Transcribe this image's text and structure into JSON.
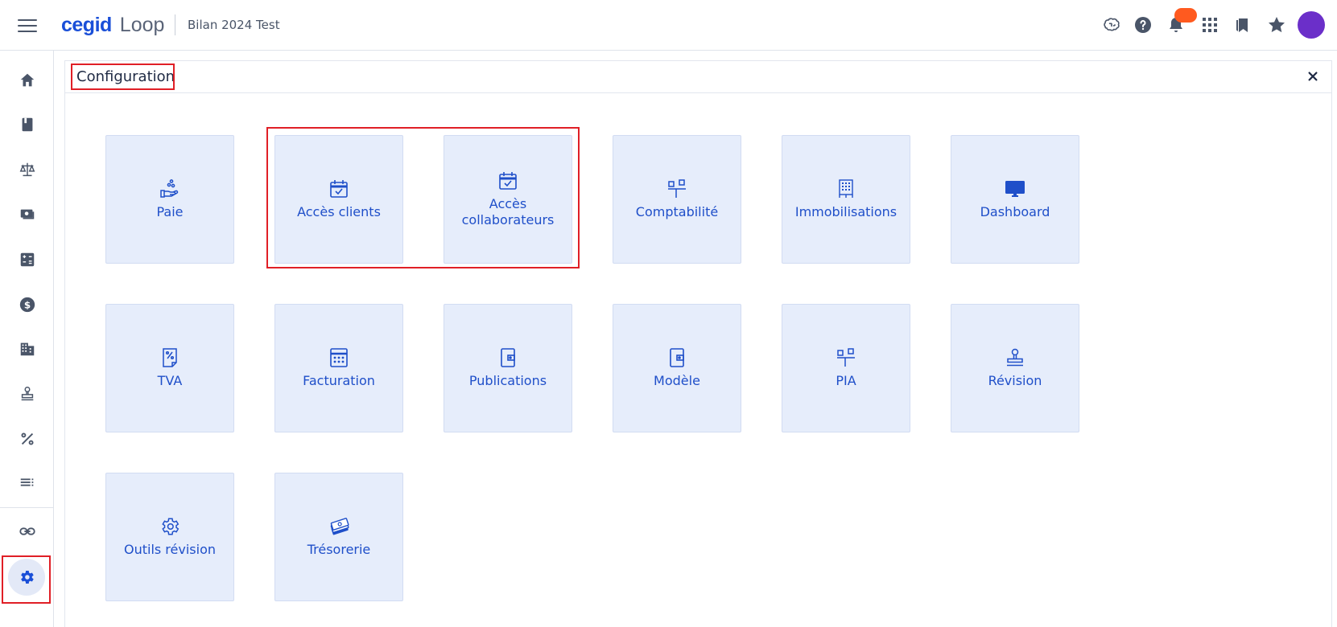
{
  "header": {
    "brand_primary": "cegid",
    "brand_secondary": "Loop",
    "document_title": "Bilan 2024 Test",
    "icons": [
      "brain-icon",
      "help-icon",
      "bell-icon",
      "apps-grid-icon",
      "bookmarks-icon",
      "star-icon",
      "avatar"
    ]
  },
  "sidebar": {
    "items": [
      {
        "icon": "home-icon"
      },
      {
        "icon": "book-icon"
      },
      {
        "icon": "scale-icon"
      },
      {
        "icon": "payments-icon"
      },
      {
        "icon": "calculator-icon"
      },
      {
        "icon": "dollar-icon"
      },
      {
        "icon": "building-icon"
      },
      {
        "icon": "stamp-icon"
      },
      {
        "icon": "percent-icon"
      },
      {
        "icon": "list-icon"
      },
      {
        "icon": "link-icon"
      },
      {
        "icon": "settings-icon",
        "active": true
      }
    ]
  },
  "panel": {
    "title": "Configuration",
    "tiles": [
      {
        "label": "Paie",
        "icon": "hand-coins-icon"
      },
      {
        "label": "Accès clients",
        "icon": "calendar-check-icon"
      },
      {
        "label": "Accès collaborateurs",
        "icon": "calendar-check-icon"
      },
      {
        "label": "Comptabilité",
        "icon": "org-chart-icon"
      },
      {
        "label": "Immobilisations",
        "icon": "building-grid-icon"
      },
      {
        "label": "Dashboard",
        "icon": "monitor-icon"
      },
      {
        "label": "TVA",
        "icon": "percent-doc-icon"
      },
      {
        "label": "Facturation",
        "icon": "calculator-icon"
      },
      {
        "label": "Publications",
        "icon": "wallet-icon"
      },
      {
        "label": "Modèle",
        "icon": "wallet-icon"
      },
      {
        "label": "PIA",
        "icon": "org-chart-icon"
      },
      {
        "label": "Révision",
        "icon": "stamp-icon"
      },
      {
        "label": "Outils révision",
        "icon": "gear-icon"
      },
      {
        "label": "Trésorerie",
        "icon": "money-stack-icon"
      }
    ]
  },
  "colors": {
    "accent": "#1a4fd8",
    "tile_bg": "#e6edfb",
    "highlight": "#e01f26",
    "avatar": "#6b2fc9",
    "badge": "#ff5a1f"
  }
}
